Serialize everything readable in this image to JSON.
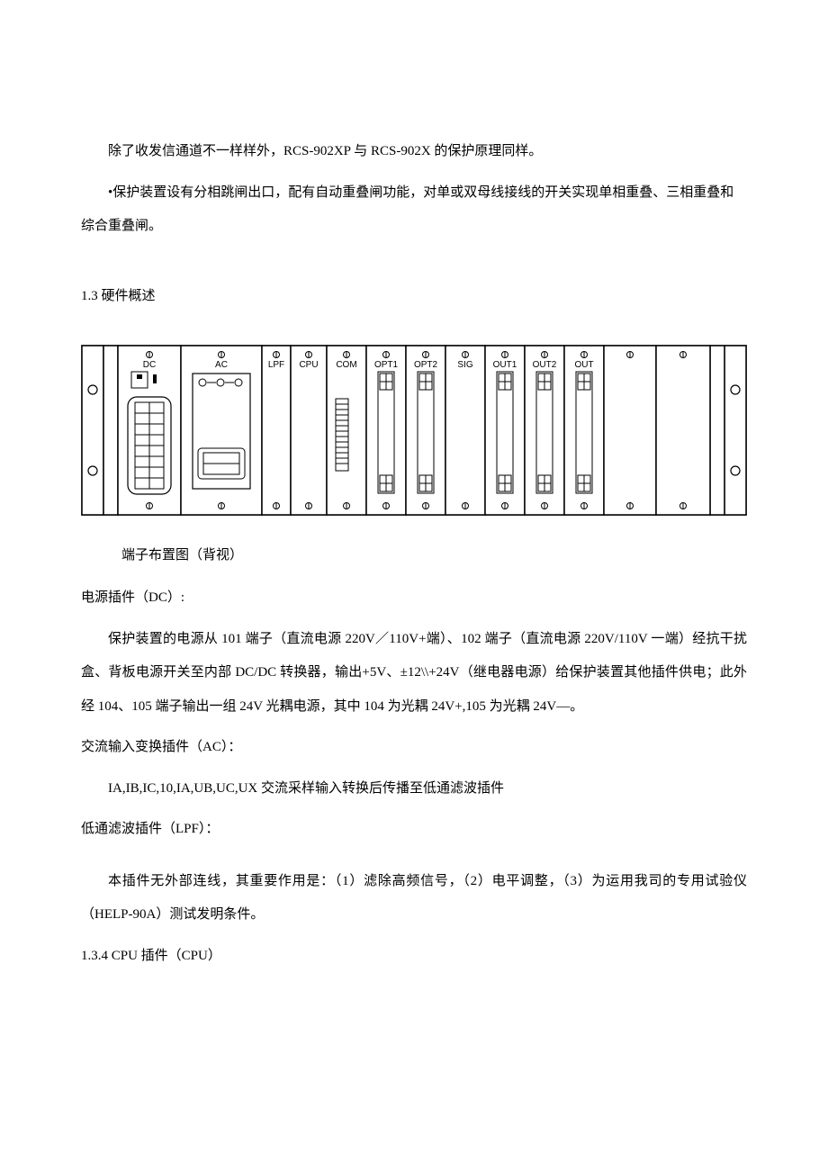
{
  "para1": "除了收发信通道不一样样外，RCS-902XP 与 RCS-902X 的保护原理同样。",
  "para2": "•保护装置设有分相跳闸出口，配有自动重叠闸功能，对单或双母线接线的开关实现单相重叠、三相重叠和综合重叠闸。",
  "section_header": "1.3 硬件概述",
  "diagram": {
    "caption": "端子布置图（背视）",
    "slots": [
      "DC",
      "AC",
      "LPF",
      "CPU",
      "COM",
      "OPT1",
      "OPT2",
      "SIG",
      "OUT1",
      "OUT2",
      "OUT",
      "",
      ""
    ]
  },
  "dc": {
    "title": "电源插件（DC）:",
    "body": "保护装置的电源从 101 端子（直流电源 220V／110V+端）、102 端子（直流电源 220V/110V 一端）经抗干扰盒、背板电源开关至内部 DC/DC 转换器，输出+5V、±12\\\\+24V（继电器电源）给保护装置其他插件供电；此外经 104、105 端子输出一组 24V 光耦电源，其中 104 为光耦 24V+,105 为光耦 24V—。"
  },
  "ac": {
    "title": "交流输入变换插件（AC）：",
    "body": "IA,IB,IC,10,IA,UB,UC,UX 交流采样输入转换后传播至低通滤波插件"
  },
  "lpf": {
    "title": "低通滤波插件（LPF）：",
    "body": "本插件无外部连线，其重要作用是：（1）滤除高频信号，（2）电平调整，（3）为运用我司的专用试验仪（HELP-90A）测试发明条件。"
  },
  "cpu": {
    "title": "1.3.4  CPU 插件（CPU）"
  }
}
